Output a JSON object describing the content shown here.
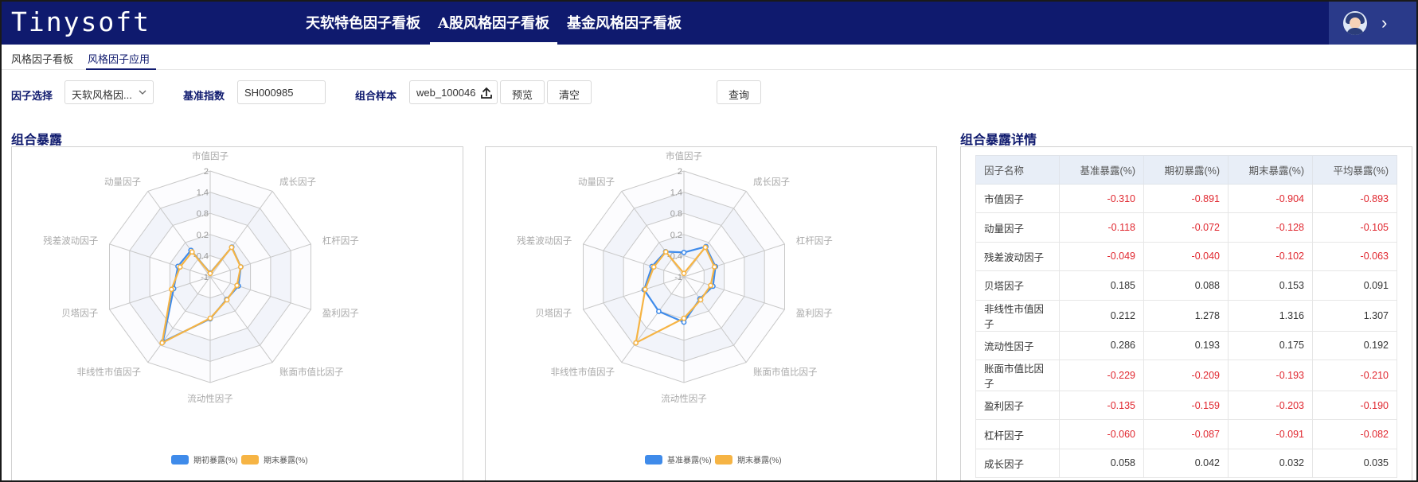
{
  "app": {
    "logo": "Tinysoft"
  },
  "nav": [
    "天软特色因子看板",
    "A股风格因子看板",
    "基金风格因子看板"
  ],
  "subtabs": [
    "风格因子看板",
    "风格因子应用"
  ],
  "filters": {
    "factor_label": "因子选择",
    "factor_value": "天软风格因...",
    "benchmark_label": "基准指数",
    "benchmark_value": "SH000985",
    "sample_label": "组合样本",
    "sample_value": "web_100046",
    "preview": "预览",
    "clear": "清空",
    "query": "查询"
  },
  "sections": {
    "exposure": "组合暴露",
    "detail": "组合暴露详情"
  },
  "chart_data": [
    {
      "type": "radar",
      "indicators": [
        "市值因子",
        "成长因子",
        "杠杆因子",
        "盈利因子",
        "账面市值比因子",
        "流动性因子",
        "非线性市值因子",
        "贝塔因子",
        "残差波动因子",
        "动量因子"
      ],
      "ticks": [
        "-1",
        "-0.4",
        "0.2",
        "0.8",
        "1.4",
        "2"
      ],
      "range": [
        -1,
        2
      ],
      "grid": "split-area",
      "legend_position": "bottom-center",
      "series": [
        {
          "name": "期初暴露(%)",
          "color": "#3f8bea",
          "values": [
            -0.891,
            0.042,
            -0.087,
            -0.159,
            -0.209,
            0.193,
            1.278,
            0.088,
            -0.04,
            -0.072
          ]
        },
        {
          "name": "期末暴露(%)",
          "color": "#f6b444",
          "values": [
            -0.904,
            0.032,
            -0.091,
            -0.203,
            -0.193,
            0.175,
            1.316,
            0.153,
            -0.102,
            -0.128
          ]
        }
      ]
    },
    {
      "type": "radar",
      "indicators": [
        "市值因子",
        "成长因子",
        "杠杆因子",
        "盈利因子",
        "账面市值比因子",
        "流动性因子",
        "非线性市值因子",
        "贝塔因子",
        "残差波动因子",
        "动量因子"
      ],
      "ticks": [
        "-1",
        "-0.4",
        "0.2",
        "0.8",
        "1.4",
        "2"
      ],
      "range": [
        -1,
        2
      ],
      "grid": "split-area",
      "legend_position": "bottom-center",
      "series": [
        {
          "name": "基准暴露(%)",
          "color": "#3f8bea",
          "values": [
            -0.31,
            0.058,
            -0.06,
            -0.135,
            -0.229,
            0.286,
            0.212,
            0.185,
            -0.049,
            -0.118
          ]
        },
        {
          "name": "期末暴露(%)",
          "color": "#f6b444",
          "values": [
            -0.904,
            0.032,
            -0.091,
            -0.203,
            -0.193,
            0.175,
            1.316,
            0.153,
            -0.102,
            -0.128
          ]
        }
      ]
    }
  ],
  "table": {
    "columns": [
      "因子名称",
      "基准暴露(%)",
      "期初暴露(%)",
      "期末暴露(%)",
      "平均暴露(%)"
    ],
    "rows": [
      [
        "市值因子",
        "-0.310",
        "-0.891",
        "-0.904",
        "-0.893"
      ],
      [
        "动量因子",
        "-0.118",
        "-0.072",
        "-0.128",
        "-0.105"
      ],
      [
        "残差波动因子",
        "-0.049",
        "-0.040",
        "-0.102",
        "-0.063"
      ],
      [
        "贝塔因子",
        "0.185",
        "0.088",
        "0.153",
        "0.091"
      ],
      [
        "非线性市值因子",
        "0.212",
        "1.278",
        "1.316",
        "1.307"
      ],
      [
        "流动性因子",
        "0.286",
        "0.193",
        "0.175",
        "0.192"
      ],
      [
        "账面市值比因子",
        "-0.229",
        "-0.209",
        "-0.193",
        "-0.210"
      ],
      [
        "盈利因子",
        "-0.135",
        "-0.159",
        "-0.203",
        "-0.190"
      ],
      [
        "杠杆因子",
        "-0.060",
        "-0.087",
        "-0.091",
        "-0.082"
      ],
      [
        "成长因子",
        "0.058",
        "0.042",
        "0.032",
        "0.035"
      ]
    ],
    "negative_color": "#e0262e"
  }
}
